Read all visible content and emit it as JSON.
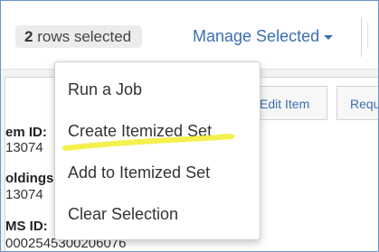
{
  "toolbar": {
    "selected_count": "2",
    "selected_text": "rows selected",
    "manage_label": "Manage Selected",
    "manage_icon": "chevron-down-icon"
  },
  "record": {
    "actions": [
      "Edit Item",
      "Requ"
    ],
    "fields": [
      {
        "label": "em ID:",
        "value": "13074"
      },
      {
        "label": "oldings",
        "value": "13074"
      },
      {
        "label": "MS ID:",
        "value": "0002545300206076"
      }
    ]
  },
  "menu": {
    "items": [
      "Run a Job",
      "Create Itemized Set",
      "Add to Itemized Set",
      "Clear Selection"
    ],
    "highlight_color": "#f4ee3a"
  },
  "colors": {
    "link": "#3a6fb0",
    "border": "#6a95c9",
    "pill_bg": "#ececec"
  }
}
